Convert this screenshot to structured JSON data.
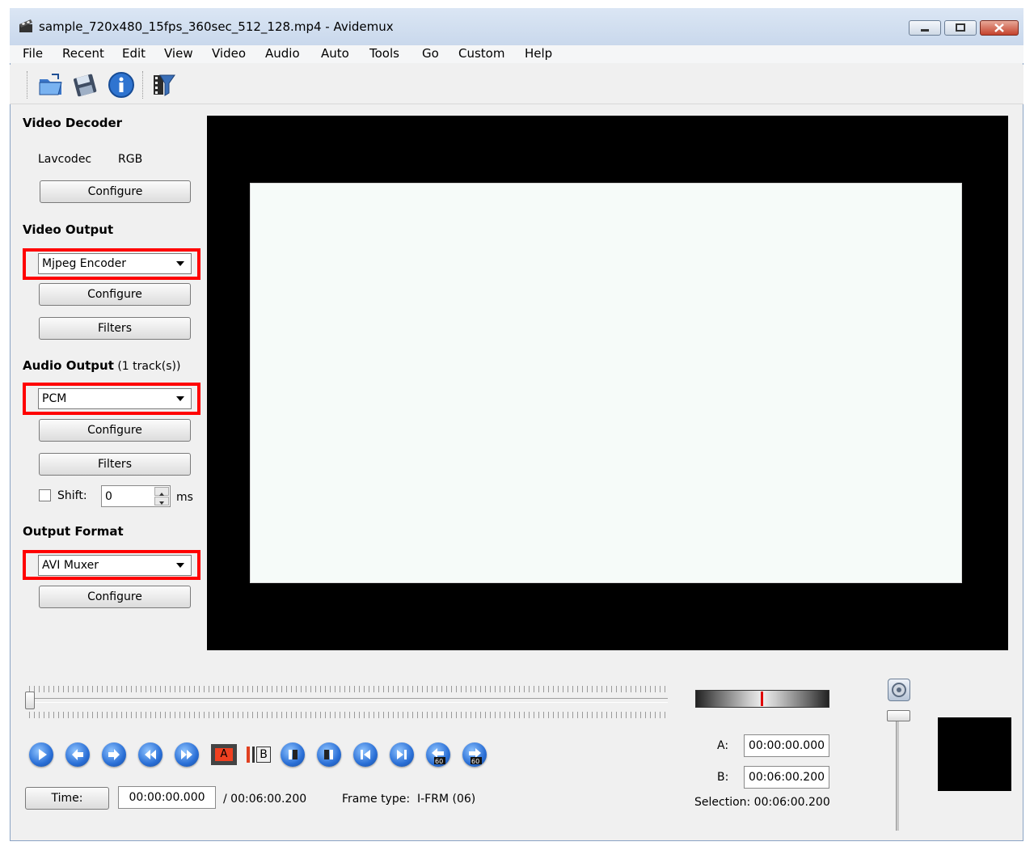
{
  "window": {
    "title": "sample_720x480_15fps_360sec_512_128.mp4 - Avidemux"
  },
  "menu": [
    "File",
    "Recent",
    "Edit",
    "View",
    "Video",
    "Audio",
    "Auto",
    "Tools",
    "Go",
    "Custom",
    "Help"
  ],
  "toolbar": {
    "icons": [
      "open-folder-icon",
      "save-disk-icon",
      "info-icon",
      "film-filter-icon"
    ]
  },
  "video_decoder": {
    "heading": "Video Decoder",
    "decoder": "Lavcodec",
    "colorspace": "RGB",
    "configure_label": "Configure"
  },
  "video_output": {
    "heading": "Video Output",
    "encoder": "Mjpeg Encoder",
    "configure_label": "Configure",
    "filters_label": "Filters"
  },
  "audio_output": {
    "heading": "Audio Output",
    "tracks": "(1 track(s))",
    "encoder": "PCM",
    "configure_label": "Configure",
    "filters_label": "Filters",
    "shift_label": "Shift:",
    "shift_value": "0",
    "shift_unit": "ms",
    "shift_checked": false
  },
  "output_format": {
    "heading": "Output Format",
    "muxer": "AVI Muxer",
    "configure_label": "Configure"
  },
  "playback": {
    "slider_position": 0,
    "markers": {
      "a": "A",
      "b": "B"
    }
  },
  "status": {
    "time_button": "Time:",
    "current_time": "00:00:00.000",
    "total_time": "/ 00:06:00.200",
    "frame_type_label": "Frame type:",
    "frame_type_value": "I-FRM (06)"
  },
  "selection": {
    "a_label": "A:",
    "a_value": "00:00:00.000",
    "b_label": "B:",
    "b_value": "00:06:00.200",
    "selection_text": "Selection: 00:06:00.200"
  },
  "colors": {
    "highlight_red": "#ff0000",
    "button_blue": "#2a6fd6"
  }
}
